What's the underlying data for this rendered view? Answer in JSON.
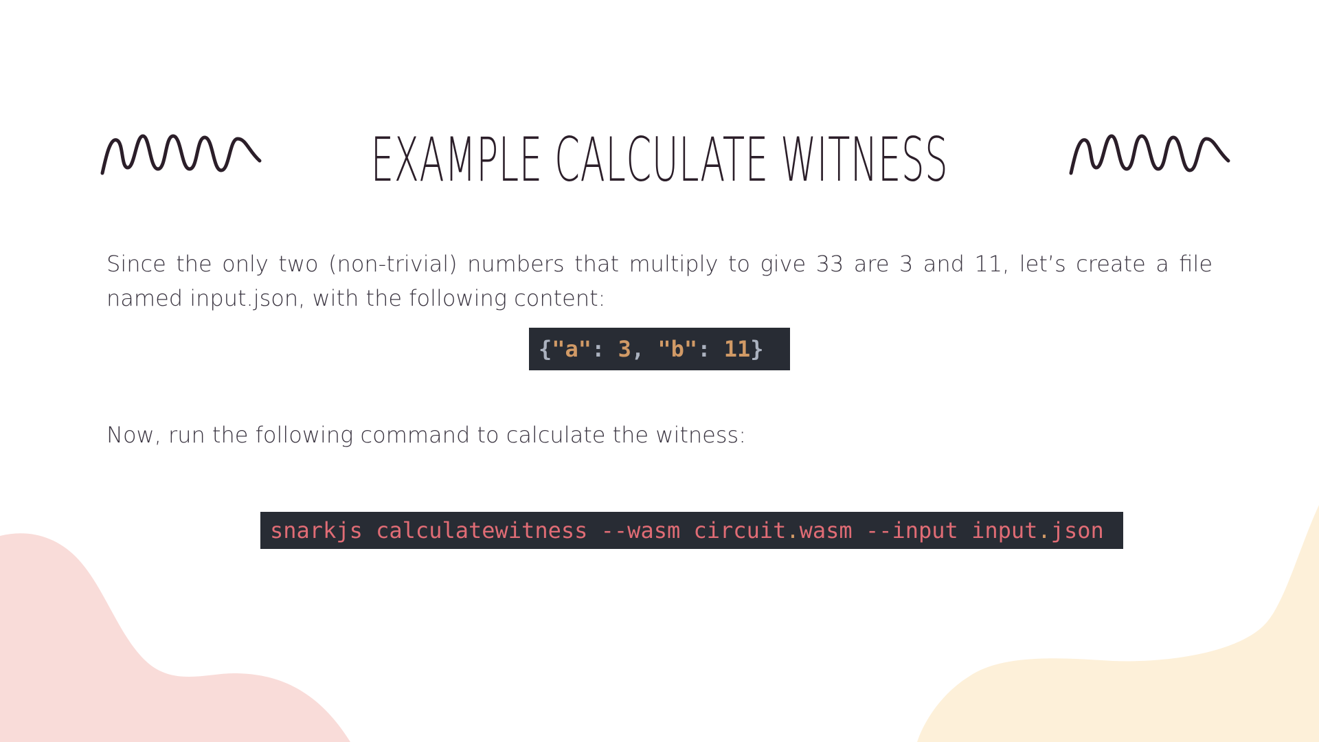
{
  "slide": {
    "title": "EXAMPLE CALCULATE WITNESS",
    "paragraph_1": "Since the only two (non-trivial) numbers that multiply to give 33 are 3 and 11, let’s create a file named input.json, with the following content:",
    "paragraph_2": "Now, run the following command to calculate the witness:"
  },
  "code_json": {
    "open_brace": "{",
    "key_a": "\"a\"",
    "colon_1": ": ",
    "value_a": "3",
    "comma": ", ",
    "key_b": "\"b\"",
    "colon_2": ": ",
    "value_b": "11",
    "close_brace": "}"
  },
  "code_command": {
    "part_1": "snarkjs calculatewitness --wasm circuit",
    "dot_1": ".",
    "part_2": "wasm --input input",
    "dot_2": ".",
    "part_3": "json"
  },
  "colors": {
    "blob_pink": "#f9dcd9",
    "blob_cream": "#fdf0d9",
    "code_background": "#282c34",
    "command_text": "#e06c75",
    "json_value": "#d19a66",
    "title_text": "#2b1e29"
  },
  "decorations": [
    "squiggle-icon",
    "squiggle-icon"
  ]
}
